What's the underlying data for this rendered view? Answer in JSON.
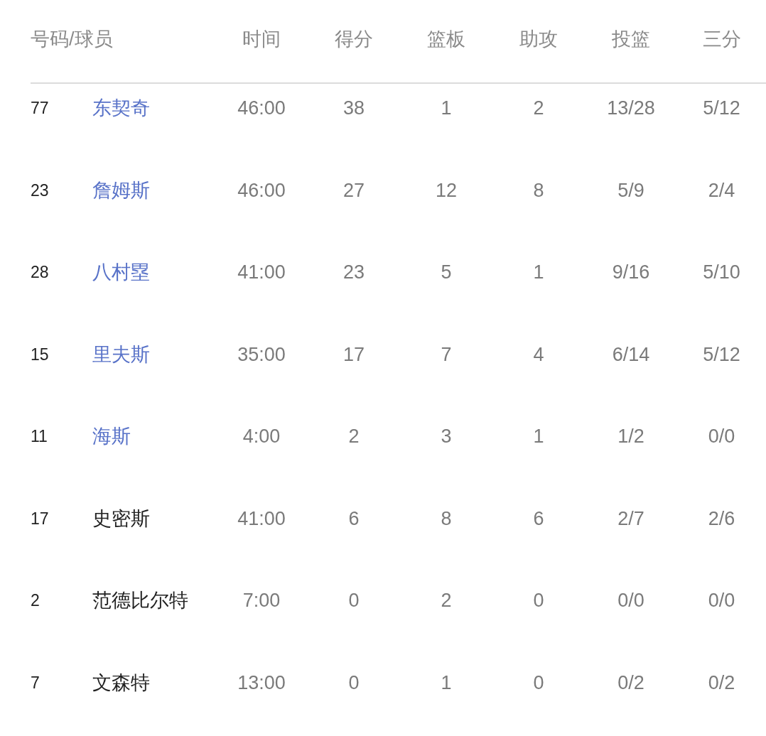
{
  "table": {
    "player_header": "号码/球员",
    "columns": [
      "时间",
      "得分",
      "篮板",
      "助攻",
      "投篮",
      "三分"
    ],
    "rows": [
      {
        "number": "77",
        "player": "东契奇",
        "linked": true,
        "cells": [
          "46:00",
          "38",
          "1",
          "2",
          "13/28",
          "5/12"
        ]
      },
      {
        "number": "23",
        "player": "詹姆斯",
        "linked": true,
        "cells": [
          "46:00",
          "27",
          "12",
          "8",
          "5/9",
          "2/4"
        ]
      },
      {
        "number": "28",
        "player": "八村塁",
        "linked": true,
        "cells": [
          "41:00",
          "23",
          "5",
          "1",
          "9/16",
          "5/10"
        ]
      },
      {
        "number": "15",
        "player": "里夫斯",
        "linked": true,
        "cells": [
          "35:00",
          "17",
          "7",
          "4",
          "6/14",
          "5/12"
        ]
      },
      {
        "number": "11",
        "player": "海斯",
        "linked": true,
        "cells": [
          "4:00",
          "2",
          "3",
          "1",
          "1/2",
          "0/0"
        ]
      },
      {
        "number": "17",
        "player": "史密斯",
        "linked": false,
        "cells": [
          "41:00",
          "6",
          "8",
          "6",
          "2/7",
          "2/6"
        ]
      },
      {
        "number": "2",
        "player": "范德比尔特",
        "linked": false,
        "cells": [
          "7:00",
          "0",
          "2",
          "0",
          "0/0",
          "0/0"
        ]
      },
      {
        "number": "7",
        "player": "文森特",
        "linked": false,
        "cells": [
          "13:00",
          "0",
          "1",
          "0",
          "0/2",
          "0/2"
        ]
      }
    ]
  }
}
